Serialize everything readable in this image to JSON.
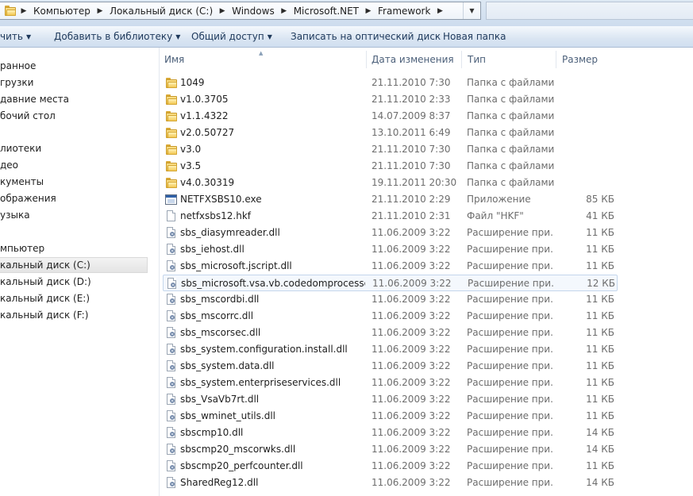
{
  "address": {
    "crumbs": [
      "Компьютер",
      "Локальный диск (C:)",
      "Windows",
      "Microsoft.NET",
      "Framework"
    ],
    "separator": "▶",
    "dropdown": "▼"
  },
  "toolbar": {
    "items": [
      {
        "label": "чить",
        "has_arrow": true
      },
      {
        "label": "Добавить в библиотеку",
        "has_arrow": true
      },
      {
        "label": "Общий доступ",
        "has_arrow": true
      },
      {
        "label": "Записать на оптический диск",
        "has_arrow": false
      },
      {
        "label": "Новая папка",
        "has_arrow": false
      }
    ],
    "arrow": "▼"
  },
  "nav": {
    "items": [
      {
        "label": "ранное"
      },
      {
        "label": "грузки"
      },
      {
        "label": "давние места"
      },
      {
        "label": "бочий стол"
      },
      {
        "label": "лиотеки"
      },
      {
        "label": "део"
      },
      {
        "label": "кументы"
      },
      {
        "label": "ображения"
      },
      {
        "label": "узыка"
      },
      {
        "label": "мпьютер"
      },
      {
        "label": "кальный диск (C:)",
        "selected": true
      },
      {
        "label": "кальный диск (D:)"
      },
      {
        "label": "кальный диск (E:)"
      },
      {
        "label": "кальный диск (F:)"
      }
    ]
  },
  "columns": {
    "name": "Имя",
    "date": "Дата изменения",
    "type": "Тип",
    "size": "Размер",
    "sort_indicator": "▲"
  },
  "files": [
    {
      "name": "1049",
      "date": "21.11.2010 7:30",
      "type": "Папка с файлами",
      "size": "",
      "icon": "folder-icon"
    },
    {
      "name": "v1.0.3705",
      "date": "21.11.2010 2:33",
      "type": "Папка с файлами",
      "size": "",
      "icon": "folder-icon"
    },
    {
      "name": "v1.1.4322",
      "date": "14.07.2009 8:37",
      "type": "Папка с файлами",
      "size": "",
      "icon": "folder-icon"
    },
    {
      "name": "v2.0.50727",
      "date": "13.10.2011 6:49",
      "type": "Папка с файлами",
      "size": "",
      "icon": "folder-icon"
    },
    {
      "name": "v3.0",
      "date": "21.11.2010 7:30",
      "type": "Папка с файлами",
      "size": "",
      "icon": "folder-icon"
    },
    {
      "name": "v3.5",
      "date": "21.11.2010 7:30",
      "type": "Папка с файлами",
      "size": "",
      "icon": "folder-icon"
    },
    {
      "name": "v4.0.30319",
      "date": "19.11.2011 20:30",
      "type": "Папка с файлами",
      "size": "",
      "icon": "folder-icon"
    },
    {
      "name": "NETFXSBS10.exe",
      "date": "21.11.2010 2:29",
      "type": "Приложение",
      "size": "85 КБ",
      "icon": "exe-icon"
    },
    {
      "name": "netfxsbs12.hkf",
      "date": "21.11.2010 2:31",
      "type": "Файл \"HKF\"",
      "size": "41 КБ",
      "icon": "file-icon"
    },
    {
      "name": "sbs_diasymreader.dll",
      "date": "11.06.2009 3:22",
      "type": "Расширение при...",
      "size": "11 КБ",
      "icon": "dll-icon"
    },
    {
      "name": "sbs_iehost.dll",
      "date": "11.06.2009 3:22",
      "type": "Расширение при...",
      "size": "11 КБ",
      "icon": "dll-icon"
    },
    {
      "name": "sbs_microsoft.jscript.dll",
      "date": "11.06.2009 3:22",
      "type": "Расширение при...",
      "size": "11 КБ",
      "icon": "dll-icon"
    },
    {
      "name": "sbs_microsoft.vsa.vb.codedomprocessor....",
      "date": "11.06.2009 3:22",
      "type": "Расширение при...",
      "size": "12 КБ",
      "icon": "dll-icon",
      "highlight": true
    },
    {
      "name": "sbs_mscordbi.dll",
      "date": "11.06.2009 3:22",
      "type": "Расширение при...",
      "size": "11 КБ",
      "icon": "dll-icon"
    },
    {
      "name": "sbs_mscorrc.dll",
      "date": "11.06.2009 3:22",
      "type": "Расширение при...",
      "size": "11 КБ",
      "icon": "dll-icon"
    },
    {
      "name": "sbs_mscorsec.dll",
      "date": "11.06.2009 3:22",
      "type": "Расширение при...",
      "size": "11 КБ",
      "icon": "dll-icon"
    },
    {
      "name": "sbs_system.configuration.install.dll",
      "date": "11.06.2009 3:22",
      "type": "Расширение при...",
      "size": "11 КБ",
      "icon": "dll-icon"
    },
    {
      "name": "sbs_system.data.dll",
      "date": "11.06.2009 3:22",
      "type": "Расширение при...",
      "size": "11 КБ",
      "icon": "dll-icon"
    },
    {
      "name": "sbs_system.enterpriseservices.dll",
      "date": "11.06.2009 3:22",
      "type": "Расширение при...",
      "size": "11 КБ",
      "icon": "dll-icon"
    },
    {
      "name": "sbs_VsaVb7rt.dll",
      "date": "11.06.2009 3:22",
      "type": "Расширение при...",
      "size": "11 КБ",
      "icon": "dll-icon"
    },
    {
      "name": "sbs_wminet_utils.dll",
      "date": "11.06.2009 3:22",
      "type": "Расширение при...",
      "size": "11 КБ",
      "icon": "dll-icon"
    },
    {
      "name": "sbscmp10.dll",
      "date": "11.06.2009 3:22",
      "type": "Расширение при...",
      "size": "14 КБ",
      "icon": "dll-icon"
    },
    {
      "name": "sbscmp20_mscorwks.dll",
      "date": "11.06.2009 3:22",
      "type": "Расширение при...",
      "size": "14 КБ",
      "icon": "dll-icon"
    },
    {
      "name": "sbscmp20_perfcounter.dll",
      "date": "11.06.2009 3:22",
      "type": "Расширение при...",
      "size": "11 КБ",
      "icon": "dll-icon"
    },
    {
      "name": "SharedReg12.dll",
      "date": "11.06.2009 3:22",
      "type": "Расширение при...",
      "size": "14 КБ",
      "icon": "dll-icon"
    }
  ]
}
